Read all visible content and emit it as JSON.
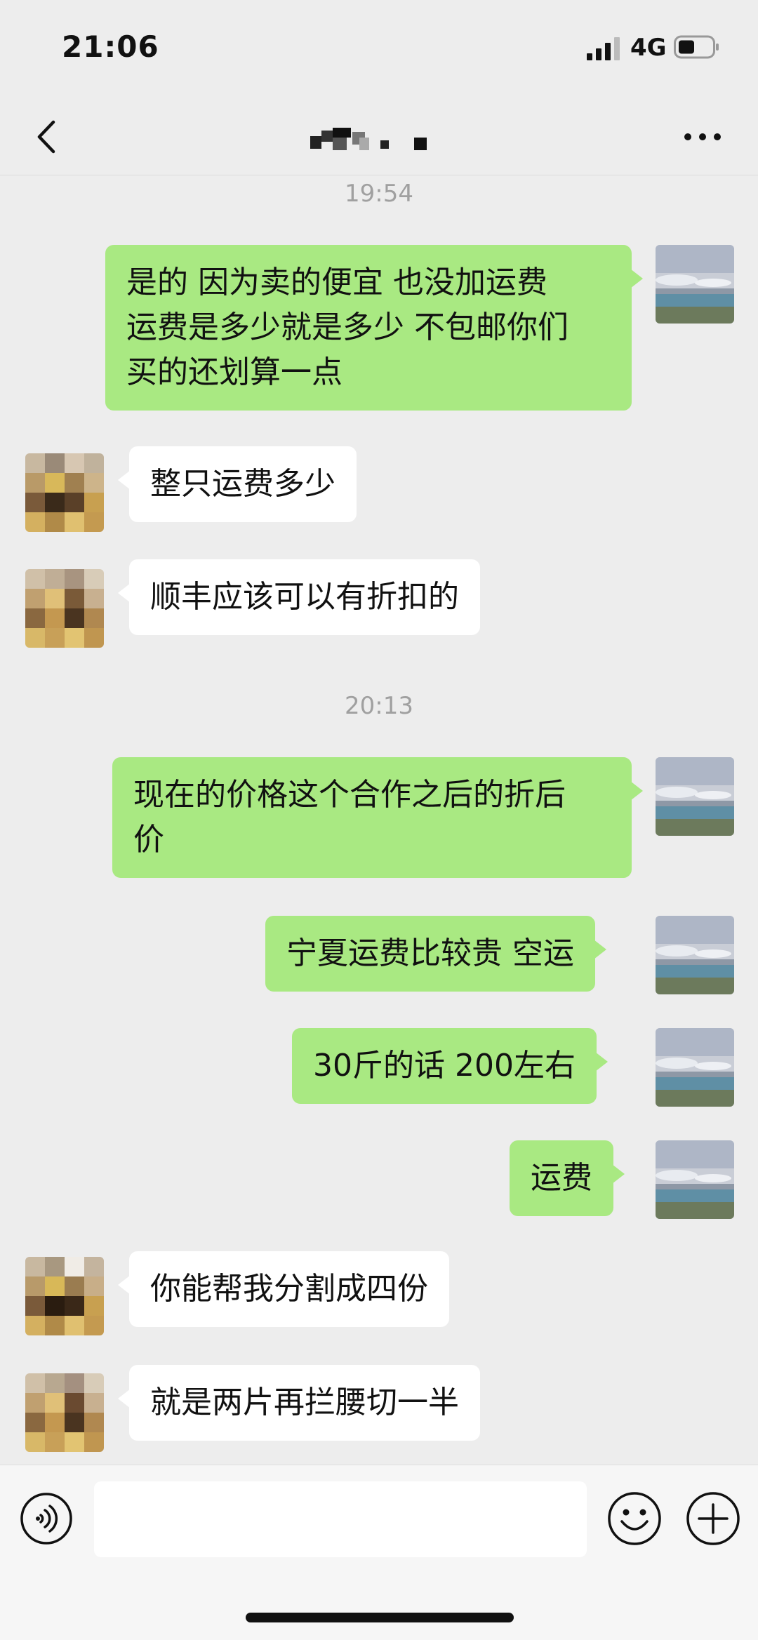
{
  "status_bar": {
    "time": "21:06",
    "network": "4G"
  },
  "chat": {
    "time_labels": [
      "19:54",
      "20:13"
    ],
    "messages": [
      {
        "side": "sent",
        "lines": [
          "是的 因为卖的便宜 也没加运费",
          "运费是多少就是多少 不包邮你们",
          "买的还划算一点"
        ]
      },
      {
        "side": "recv",
        "lines": [
          "整只运费多少"
        ]
      },
      {
        "side": "recv",
        "lines": [
          "顺丰应该可以有折扣的"
        ]
      },
      {
        "side": "sent",
        "lines": [
          "现在的价格这个合作之后的折后",
          "价"
        ]
      },
      {
        "side": "sent",
        "lines": [
          "宁夏运费比较贵 空运"
        ]
      },
      {
        "side": "sent",
        "lines": [
          "30斤的话 200左右"
        ]
      },
      {
        "side": "sent",
        "lines": [
          "运费"
        ]
      },
      {
        "side": "recv",
        "lines": [
          "你能帮我分割成四份"
        ]
      },
      {
        "side": "recv",
        "lines": [
          "就是两片再拦腰切一半"
        ]
      }
    ]
  },
  "colors": {
    "sent_bubble": "#a9e982",
    "recv_bubble": "#ffffff",
    "background": "#ededed",
    "time_label": "#a0a0a0"
  },
  "icons": {
    "back": "chevron-left-icon",
    "more": "more-dots-icon",
    "voice": "voice-icon",
    "emoji": "emoji-icon",
    "plus": "plus-icon"
  }
}
